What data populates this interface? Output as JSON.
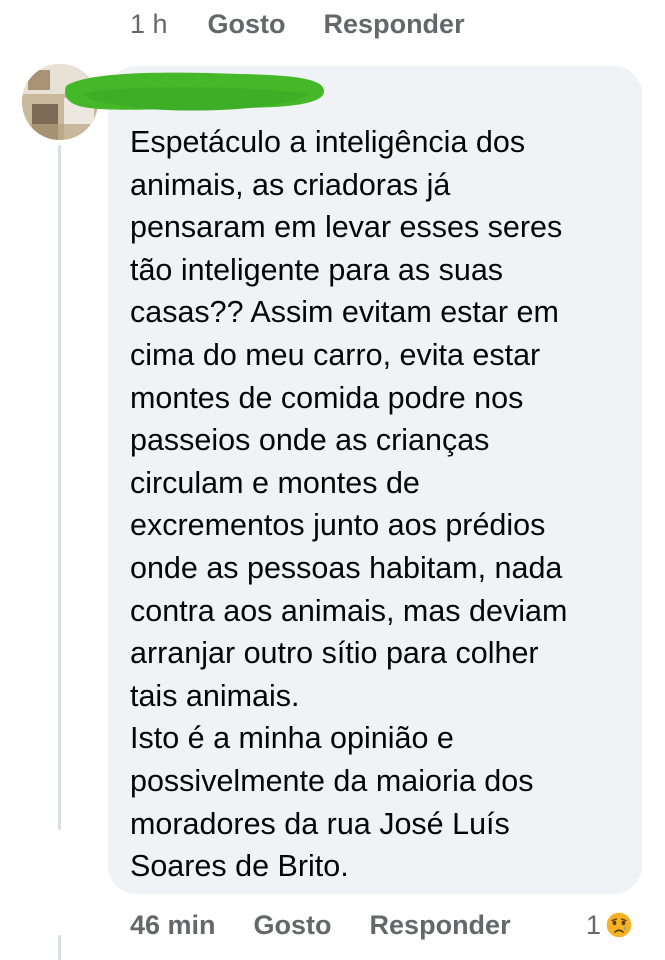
{
  "previous_comment": {
    "time": "1 h",
    "like_label": "Gosto",
    "reply_label": "Responder"
  },
  "comment": {
    "author": "",
    "text_lines": [
      "Espetáculo a inteligência dos",
      "animais, as criadoras já",
      "pensaram em levar esses seres",
      "tão inteligente para as suas",
      "casas?? Assim evitam estar em",
      "cima do meu carro, evita estar",
      "montes de comida podre nos",
      "passeios onde as crianças",
      "circulam e montes de",
      "excrementos junto aos prédios",
      "onde as pessoas habitam, nada",
      "contra aos animais, mas deviam",
      "arranjar outro sítio para colher",
      "tais animais.",
      "Isto é a minha opinião e",
      "possivelmente da maioria dos",
      "moradores da rua José Luís",
      "Soares de Brito."
    ],
    "time": "46 min",
    "like_label": "Gosto",
    "reply_label": "Responder",
    "reaction_count": "1",
    "reaction_icon": "sad-face-icon"
  },
  "colors": {
    "bubble": "#f0f2f5",
    "text": "#050505",
    "meta": "#65676b",
    "redaction": "#45b82a",
    "reaction": "#f7b125"
  }
}
